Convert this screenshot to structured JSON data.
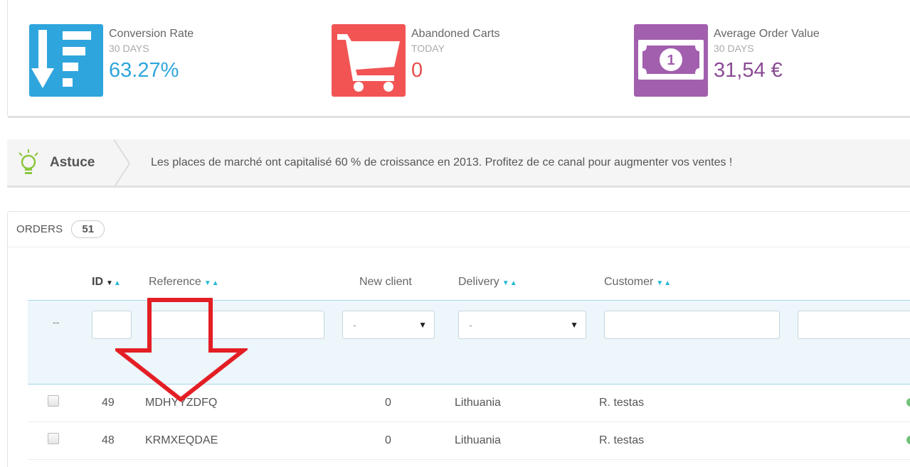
{
  "kpis": [
    {
      "title": "Conversion Rate",
      "period": "30 DAYS",
      "value": "63.27%",
      "color": "#2ea5dd",
      "value_color": "#2ea5dd",
      "icon": "sort-amount-down-icon"
    },
    {
      "title": "Abandoned Carts",
      "period": "TODAY",
      "value": "0",
      "color": "#f25454",
      "value_color": "#e84d4d",
      "icon": "shopping-cart-icon"
    },
    {
      "title": "Average Order Value",
      "period": "30 DAYS",
      "value": "31,54 €",
      "color": "#a25fae",
      "value_color": "#8a4b94",
      "icon": "money-bill-icon"
    }
  ],
  "tip": {
    "label": "Astuce",
    "text": "Les places de marché ont capitalisé 60 % de croissance en 2013. Profitez de ce canal pour augmenter vos ventes !",
    "icon": "lightbulb-icon"
  },
  "orders": {
    "title": "ORDERS",
    "count": "51",
    "columns": {
      "id": "ID",
      "reference": "Reference",
      "new_client": "New client",
      "delivery": "Delivery",
      "customer": "Customer"
    },
    "filters": {
      "dash": "--",
      "new_client_value": "-",
      "delivery_value": "-"
    },
    "rows": [
      {
        "id": "49",
        "reference": "MDHYYZDFQ",
        "new_client": "0",
        "delivery": "Lithuania",
        "customer": "R. testas"
      },
      {
        "id": "48",
        "reference": "KRMXEQDAE",
        "new_client": "0",
        "delivery": "Lithuania",
        "customer": "R. testas"
      }
    ]
  },
  "annotation": {
    "color": "#e31e24",
    "icon": "red-arrow-down-icon"
  }
}
